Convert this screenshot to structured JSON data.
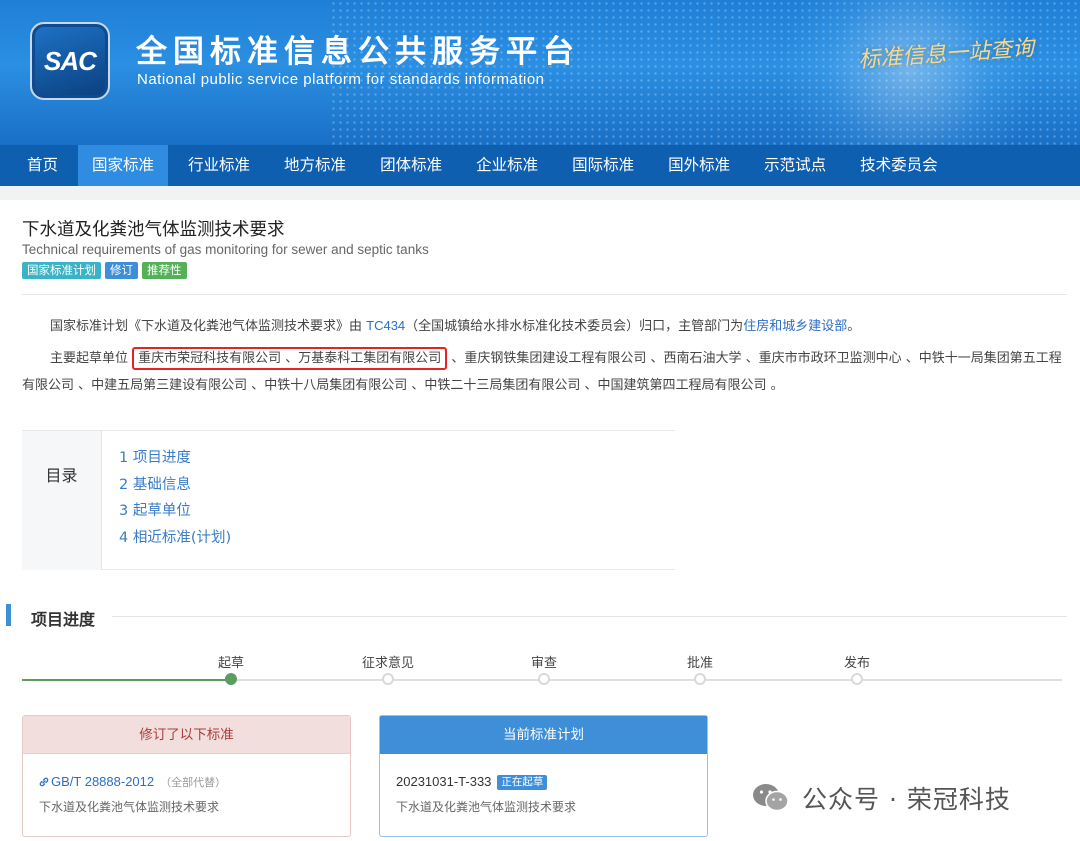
{
  "header": {
    "logo_text": "SAC",
    "title": "全国标准信息公共服务平台",
    "subtitle": "National public service platform  for standards information",
    "slogan": "标准信息一站查询"
  },
  "nav": {
    "items": [
      "首页",
      "国家标准",
      "行业标准",
      "地方标准",
      "团体标准",
      "企业标准",
      "国际标准",
      "国外标准",
      "示范试点",
      "技术委员会"
    ],
    "active": "国家标准"
  },
  "standard": {
    "title": "下水道及化粪池气体监测技术要求",
    "title_en": "Technical requirements of gas monitoring for sewer and septic tanks",
    "tags": [
      "国家标准计划",
      "修订",
      "推荐性"
    ]
  },
  "intro": {
    "p1_a": "国家标准计划《下水道及化粪池气体监测技术要求》由 ",
    "tc_link": "TC434",
    "p1_b": "（全国城镇给水排水标准化技术委员会）归口，主管部门为",
    "dept_link": "住房和城乡建设部",
    "p1_c": "。",
    "p2_lead": "主要起草单位 ",
    "p2_highlight": "重庆市荣冠科技有限公司 、万基泰科工集团有限公司",
    "p2_rest": " 、重庆钢铁集团建设工程有限公司 、西南石油大学 、重庆市市政环卫监测中心 、中铁十一局集团第五工程有限公司 、中建五局第三建设有限公司 、中铁十八局集团有限公司 、中铁二十三局集团有限公司 、中国建筑第四工程局有限公司 。"
  },
  "toc": {
    "label": "目录",
    "items": [
      "1  项目进度",
      "2  基础信息",
      "3  起草单位",
      "4  相近标准(计划)"
    ]
  },
  "progress": {
    "title": "项目进度",
    "steps": [
      "起草",
      "征求意见",
      "审查",
      "批准",
      "发布"
    ],
    "current_step": "起草"
  },
  "revised": {
    "header": "修订了以下标准",
    "code": "GB/T 28888-2012",
    "note": "（全部代替）",
    "desc": "下水道及化粪池气体监测技术要求"
  },
  "current_plan": {
    "header": "当前标准计划",
    "code": "20231031-T-333",
    "status": "正在起草",
    "desc": "下水道及化粪池气体监测技术要求"
  },
  "watermark": {
    "text": "公众号 · 荣冠科技"
  },
  "colors": {
    "nav_bg": "#0f5fb0",
    "nav_active": "#2f8ce0",
    "link": "#2b6ec6",
    "highlight_border": "#e52320",
    "progress_done": "#5d9c5f"
  }
}
